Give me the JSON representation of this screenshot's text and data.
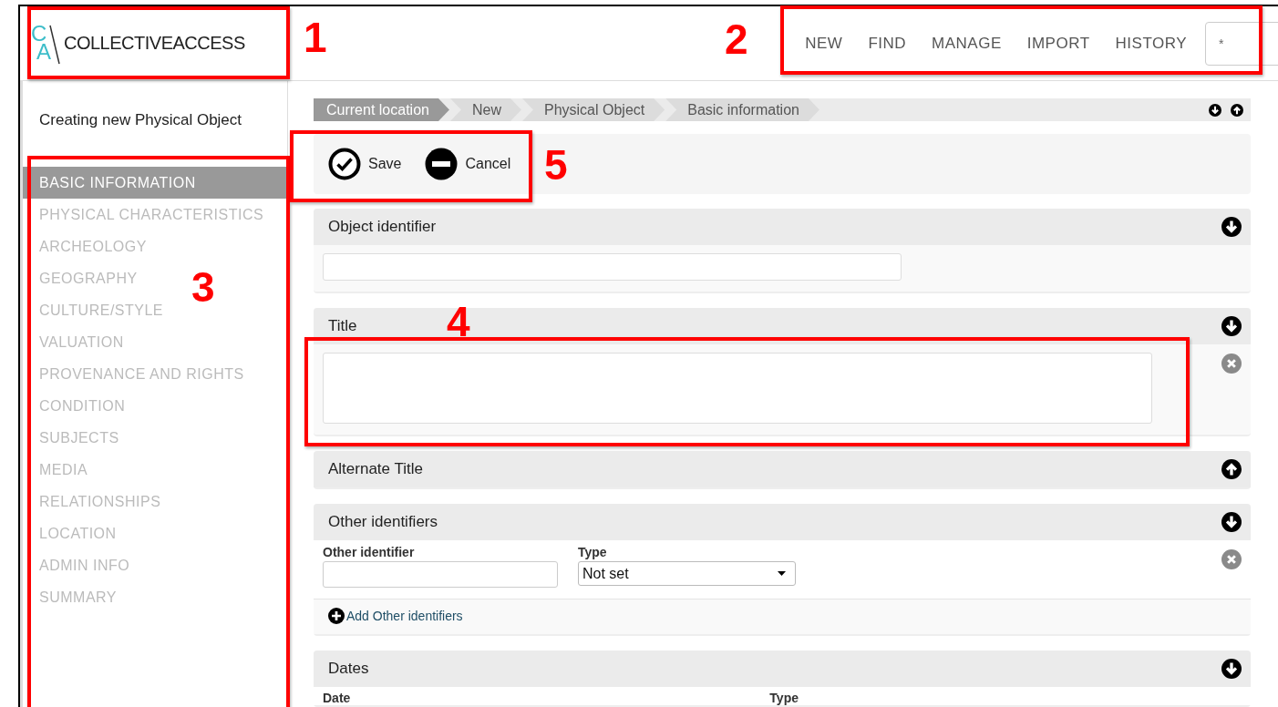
{
  "logo": {
    "mark_top": "C",
    "mark_bottom": "A",
    "wordmark": "COLLECTIVEACCESS"
  },
  "nav": [
    {
      "label": "NEW"
    },
    {
      "label": "FIND"
    },
    {
      "label": "MANAGE"
    },
    {
      "label": "IMPORT"
    },
    {
      "label": "HISTORY"
    }
  ],
  "search": {
    "value": "*"
  },
  "sidebar": {
    "heading": "Creating new Physical Object",
    "items": [
      {
        "label": "BASIC INFORMATION",
        "selected": true
      },
      {
        "label": "PHYSICAL CHARACTERISTICS",
        "selected": false
      },
      {
        "label": "ARCHEOLOGY",
        "selected": false
      },
      {
        "label": "GEOGRAPHY",
        "selected": false
      },
      {
        "label": "CULTURE/STYLE",
        "selected": false
      },
      {
        "label": "VALUATION",
        "selected": false
      },
      {
        "label": "PROVENANCE AND RIGHTS",
        "selected": false
      },
      {
        "label": "CONDITION",
        "selected": false
      },
      {
        "label": "SUBJECTS",
        "selected": false
      },
      {
        "label": "MEDIA",
        "selected": false
      },
      {
        "label": "RELATIONSHIPS",
        "selected": false
      },
      {
        "label": "LOCATION",
        "selected": false
      },
      {
        "label": "ADMIN INFO",
        "selected": false
      },
      {
        "label": "SUMMARY",
        "selected": false
      }
    ]
  },
  "breadcrumb": [
    {
      "label": "Current location",
      "selected": true
    },
    {
      "label": "New",
      "selected": false
    },
    {
      "label": "Physical Object",
      "selected": false
    },
    {
      "label": "Basic information",
      "selected": false
    }
  ],
  "toolbar": {
    "buttons": [
      {
        "label": "Save",
        "kind": "save"
      },
      {
        "label": "Cancel",
        "kind": "cancel"
      }
    ]
  },
  "sections": [
    {
      "kind": "text",
      "title": "Object identifier",
      "expanded": true,
      "removable": false
    },
    {
      "kind": "textarea",
      "title": "Title",
      "expanded": true,
      "removable": true
    },
    {
      "title": "Alternate Title",
      "expanded": false
    },
    {
      "kind": "identifiers",
      "title": "Other identifiers",
      "expanded": true,
      "removable": true,
      "field_label": "Other identifier",
      "type_label": "Type",
      "type_value": "Not set",
      "add_link": "Add Other identifiers"
    },
    {
      "kind": "dates",
      "title": "Dates",
      "expanded": true,
      "removable": false,
      "field_label": "Date",
      "type_label": "Type"
    }
  ],
  "annotations": [
    {
      "number": "1"
    },
    {
      "number": "2"
    },
    {
      "number": "3"
    },
    {
      "number": "4"
    },
    {
      "number": "5"
    }
  ]
}
